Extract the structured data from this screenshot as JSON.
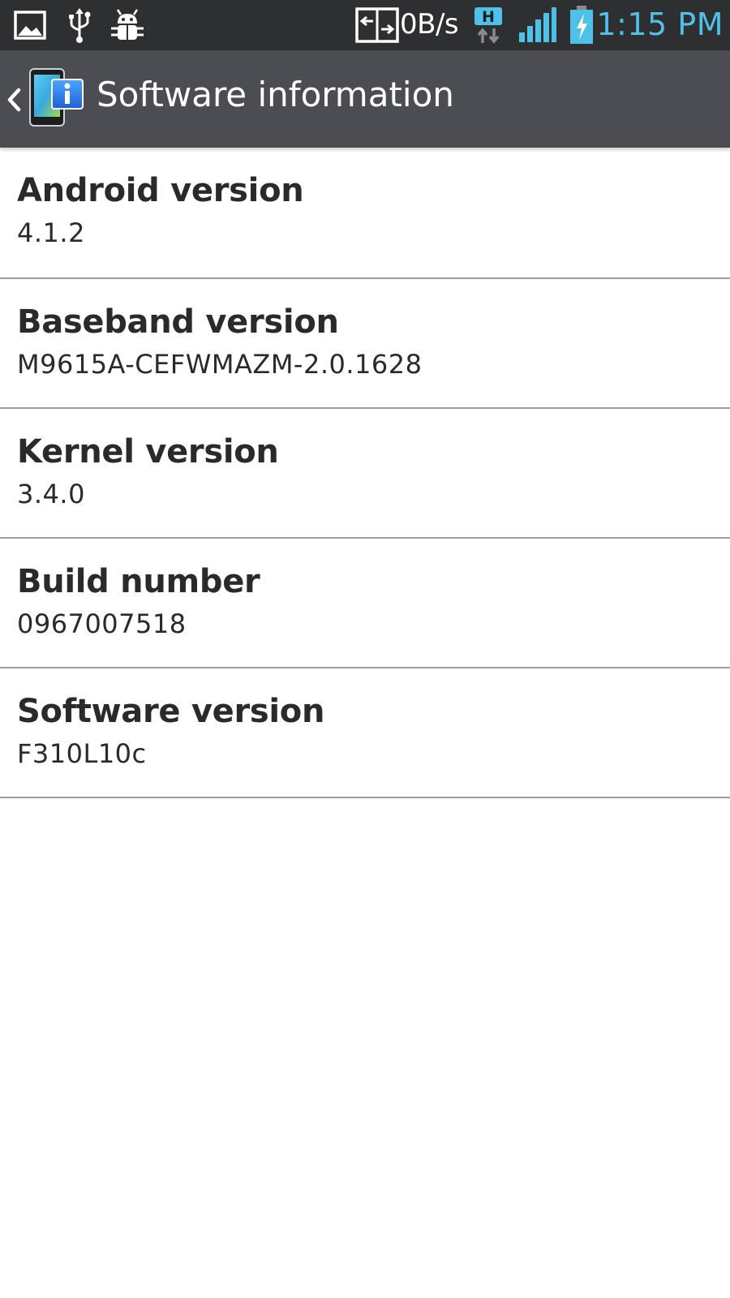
{
  "status_bar": {
    "icons_left": [
      "picture-icon",
      "usb-icon",
      "debug-icon"
    ],
    "transfer_icon": "data-transfer-icon",
    "speed": "0B/s",
    "network_type": "H",
    "signal_icon": "signal-bars-icon",
    "battery_icon": "battery-charging-icon",
    "time": "1:15 PM",
    "accent_color": "#4fc1e8"
  },
  "action_bar": {
    "back_icon": "chevron-left-icon",
    "app_icon": "software-info-icon",
    "title": "Software information",
    "background_color": "#4b4d52"
  },
  "items": [
    {
      "title": "Android version",
      "value": "4.1.2"
    },
    {
      "title": "Baseband version",
      "value": "M9615A-CEFWMAZM-2.0.1628"
    },
    {
      "title": "Kernel version",
      "value": "3.4.0"
    },
    {
      "title": "Build number",
      "value": "0967007518"
    },
    {
      "title": "Software version",
      "value": "F310L10c"
    }
  ]
}
